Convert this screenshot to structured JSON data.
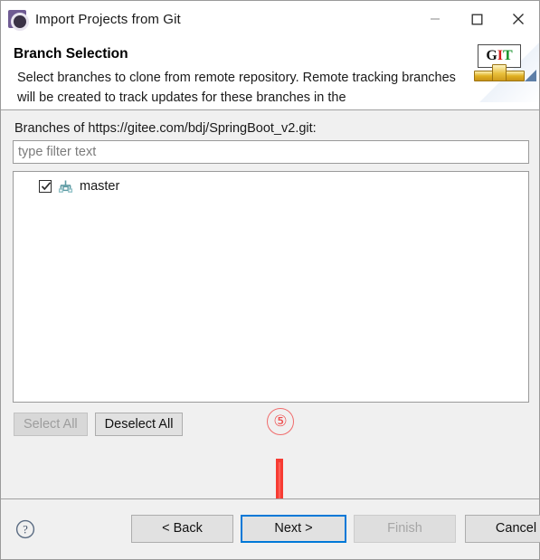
{
  "window": {
    "title": "Import Projects from Git",
    "app_icon": "eclipse-gear-icon",
    "controls": {
      "minimize": "minimize-icon",
      "maximize": "maximize-icon",
      "close": "close-icon"
    }
  },
  "header": {
    "title": "Branch Selection",
    "description": "Select branches to clone from remote repository. Remote tracking branches will be created to track updates for these branches in the",
    "logo": {
      "g": "G",
      "i": "I",
      "t": "T"
    }
  },
  "main": {
    "branches_label": "Branches of https://gitee.com/bdj/SpringBoot_v2.git:",
    "filter": {
      "value": "",
      "placeholder": "type filter text"
    },
    "branches": [
      {
        "name": "master",
        "checked": true,
        "icon": "branch-icon"
      }
    ],
    "select_all_label": "Select All",
    "select_all_enabled": false,
    "deselect_all_label": "Deselect All",
    "deselect_all_enabled": true
  },
  "annotations": {
    "step_marker": "⑤",
    "marker_color": "#ee4a4a",
    "arrow_color": "#f73b32",
    "arrow_target": "Next >"
  },
  "footer": {
    "help_label": "?",
    "back_label": "< Back",
    "next_label": "Next >",
    "finish_label": "Finish",
    "cancel_label": "Cancel",
    "finish_enabled": false,
    "focused_button": "Next >",
    "focus_color": "#0078d7"
  }
}
